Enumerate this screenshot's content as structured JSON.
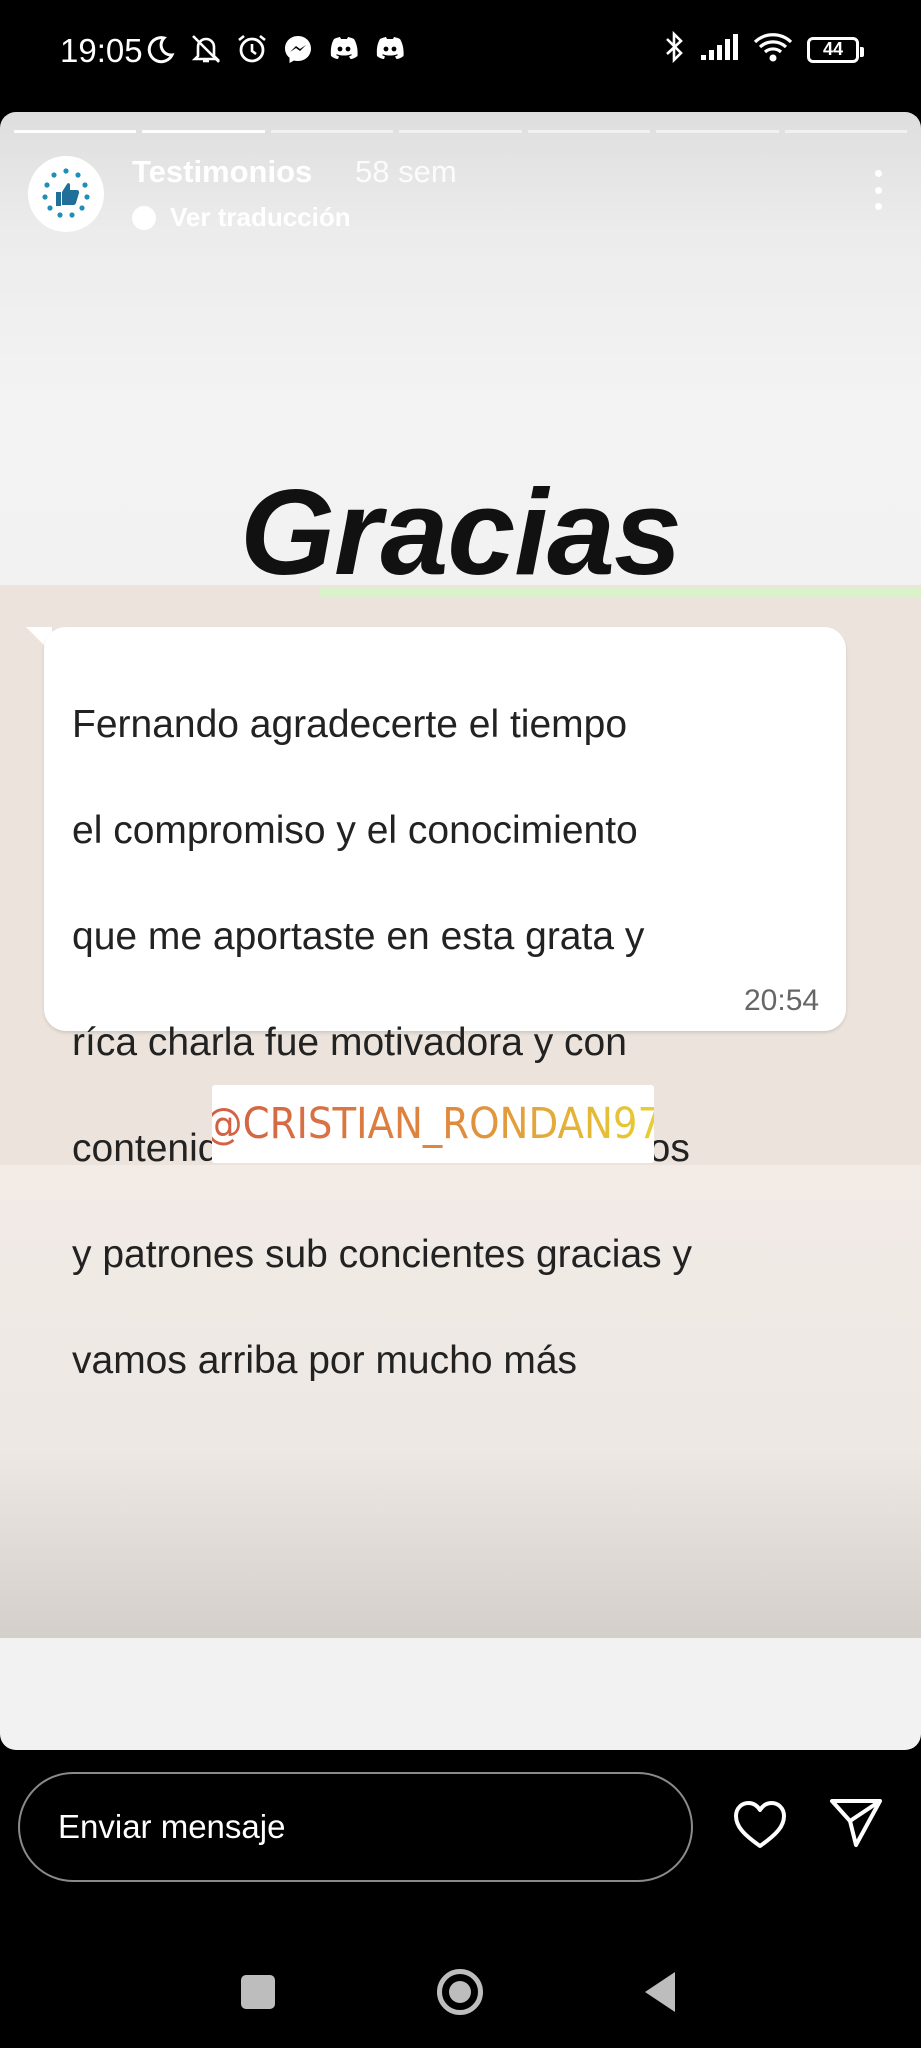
{
  "status_bar": {
    "time": "19:05",
    "left_icons": [
      "moon-icon",
      "notifications-off-icon",
      "alarm-icon",
      "messenger-icon",
      "discord-icon",
      "discord-icon"
    ],
    "right_icons": [
      "bluetooth-icon",
      "signal-icon",
      "wifi-icon"
    ],
    "battery": "44"
  },
  "story": {
    "account_name": "Testimonios",
    "time_ago": "58 sem",
    "translate_label": "Ver traducción",
    "progress_segments": 7,
    "progress_viewed": 2,
    "headline": "Gracias",
    "message": {
      "lines": [
        "Fernando agradecerte el tiempo",
        "el compromiso y el conocimiento",
        "que me aportaste en esta grata y",
        "ríca charla fue motivadora y con",
        "contenido racional derivando muros",
        "y patrones sub concientes gracias y",
        "vamos arriba por mucho más"
      ],
      "time": "20:54"
    },
    "handle": "@CRISTIAN_RONDAN97"
  },
  "reply_bar": {
    "placeholder": "Enviar mensaje",
    "like_icon": "heart-icon",
    "share_icon": "send-icon"
  },
  "nav_bar": [
    "recents-icon",
    "home-icon",
    "back-icon"
  ]
}
